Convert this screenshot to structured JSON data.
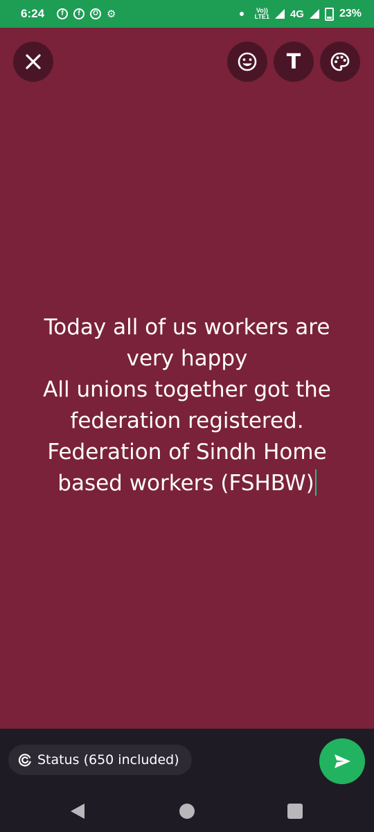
{
  "status_bar": {
    "time": "6:24",
    "notification_icons": [
      "facebook-icon",
      "facebook-icon",
      "opera-icon",
      "settings-icon"
    ],
    "volte_top": "Vo))",
    "volte_bottom": "LTE1",
    "network": "4G",
    "battery": "23%"
  },
  "toolbar": {
    "close_icon": "close-icon",
    "emoji_icon": "smiley-icon",
    "text_label": "T",
    "palette_icon": "palette-icon"
  },
  "status_text": {
    "lines": [
      "Today all of us workers are",
      "very happy",
      "All unions together got the",
      "federation registered.",
      "Federation of Sindh Home",
      "based workers (FSHBW)"
    ]
  },
  "footer": {
    "audience_label": "Status (650 included)",
    "send_icon": "send-icon"
  },
  "colors": {
    "background": "#7a2239",
    "status_bar": "#1e9d55",
    "send_button": "#21b35f",
    "caret": "#1fc17c"
  }
}
